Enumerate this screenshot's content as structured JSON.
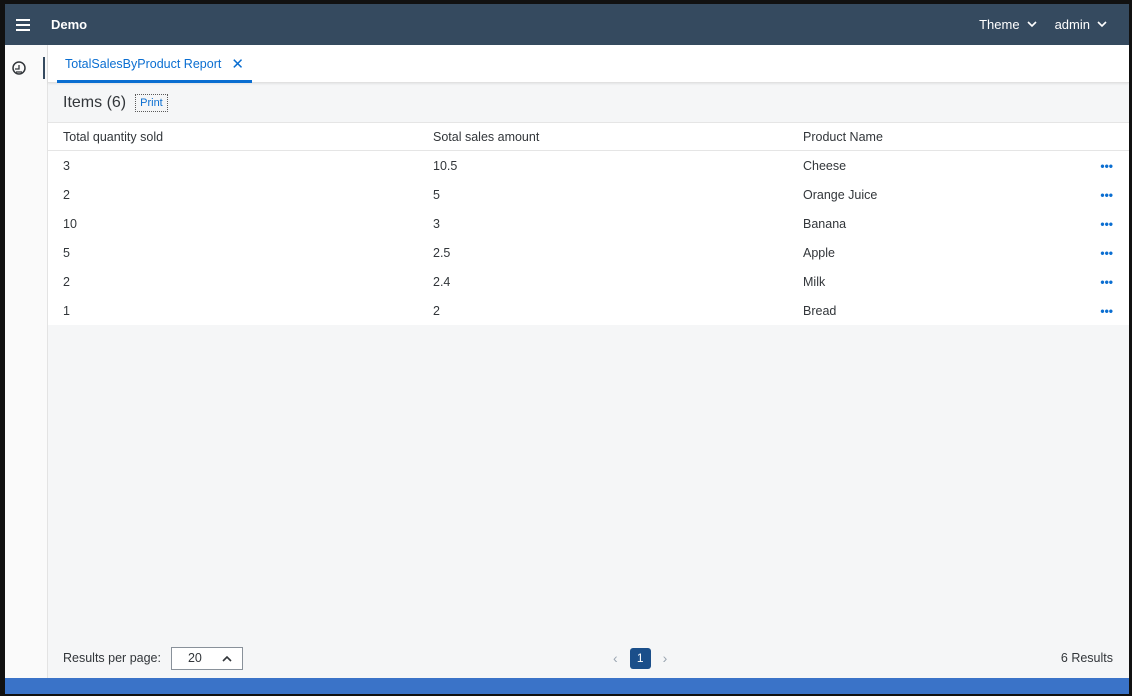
{
  "shell": {
    "app_title": "Demo",
    "theme_label": "Theme",
    "user_label": "admin"
  },
  "tab": {
    "label": "TotalSalesByProduct Report"
  },
  "toolbar": {
    "title": "Items (6)",
    "print_label": "Print"
  },
  "table": {
    "headers": [
      "Total quantity sold",
      "Sotal sales amount",
      "Product Name"
    ],
    "rows": [
      [
        "3",
        "10.5",
        "Cheese"
      ],
      [
        "2",
        "5",
        "Orange Juice"
      ],
      [
        "10",
        "3",
        "Banana"
      ],
      [
        "5",
        "2.5",
        "Apple"
      ],
      [
        "2",
        "2.4",
        "Milk"
      ],
      [
        "1",
        "2",
        "Bread"
      ]
    ],
    "row_action": "•••"
  },
  "footer": {
    "rpp_label": "Results per page:",
    "rpp_value": "20",
    "current_page": "1",
    "results_text": "6 Results"
  },
  "colors": {
    "shellbar": "#354a5f",
    "accent": "#0a6ed1",
    "page_active": "#1b4f8a",
    "bottom_bar": "#3a73c8"
  },
  "icons": {
    "menu": "hamburger-icon",
    "side": "dashboard-gauge-icon",
    "close": "close-icon",
    "chevron": "chevron-down-icon",
    "sort": "chevron-up-icon",
    "prev": "chevron-left-icon",
    "next": "chevron-right-icon",
    "more": "more-horizontal-icon"
  }
}
